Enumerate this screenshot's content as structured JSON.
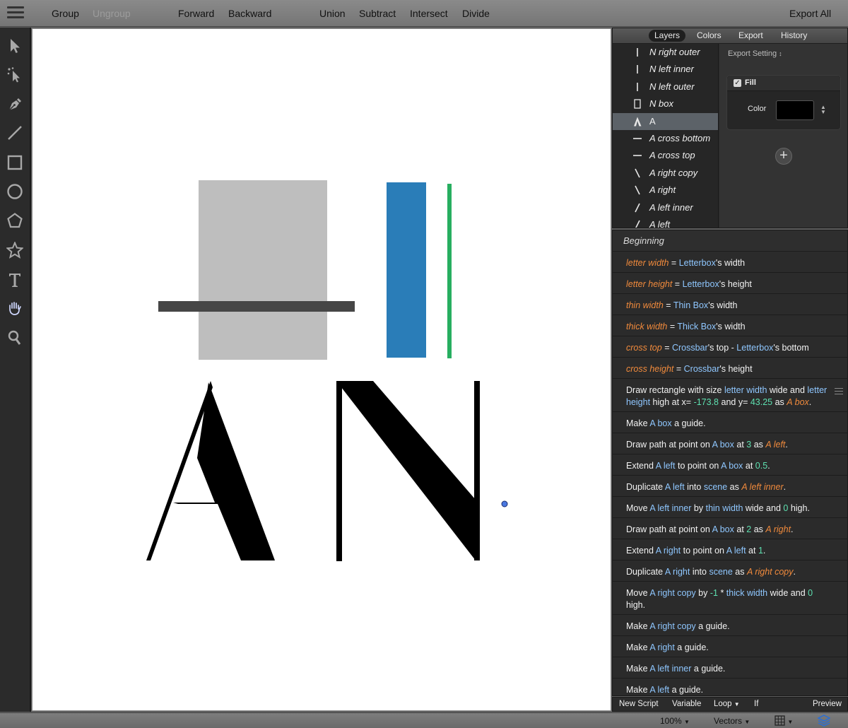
{
  "toolbar": {
    "group": "Group",
    "ungroup": "Ungroup",
    "forward": "Forward",
    "backward": "Backward",
    "union": "Union",
    "subtract": "Subtract",
    "intersect": "Intersect",
    "divide": "Divide",
    "export_all": "Export All"
  },
  "tools": [
    "select-tool",
    "direct-select-tool",
    "pen-tool",
    "line-tool",
    "rectangle-tool",
    "ellipse-tool",
    "polygon-tool",
    "star-tool",
    "text-tool",
    "hand-tool",
    "zoom-tool"
  ],
  "panel_tabs": [
    "Layers",
    "Colors",
    "Export",
    "History"
  ],
  "active_tab": "Layers",
  "layers": [
    {
      "name": "N right outer",
      "icon": "vbar"
    },
    {
      "name": "N left inner",
      "icon": "vbar"
    },
    {
      "name": "N left outer",
      "icon": "vbar"
    },
    {
      "name": "N box",
      "icon": "rect"
    },
    {
      "name": "A",
      "icon": "letter-a",
      "selected": true
    },
    {
      "name": "A cross bottom",
      "icon": "hbar"
    },
    {
      "name": "A cross top",
      "icon": "hbar"
    },
    {
      "name": "A right copy",
      "icon": "backslash"
    },
    {
      "name": "A right",
      "icon": "backslash"
    },
    {
      "name": "A left inner",
      "icon": "slash"
    },
    {
      "name": "A left",
      "icon": "slash"
    }
  ],
  "properties": {
    "export_setting": "Export Setting",
    "fill_label": "Fill",
    "fill_checked": true,
    "color_label": "Color",
    "color_value": "#000000",
    "add_label": "+"
  },
  "script": {
    "beginning": "Beginning",
    "statements": [
      [
        [
          "var",
          "letter width"
        ],
        [
          "plain",
          " = "
        ],
        [
          "ref",
          "Letterbox"
        ],
        [
          "plain",
          "'s width"
        ]
      ],
      [
        [
          "var",
          "letter height"
        ],
        [
          "plain",
          " = "
        ],
        [
          "ref",
          "Letterbox"
        ],
        [
          "plain",
          "'s height"
        ]
      ],
      [
        [
          "var",
          "thin width"
        ],
        [
          "plain",
          " = "
        ],
        [
          "ref",
          "Thin Box"
        ],
        [
          "plain",
          "'s width"
        ]
      ],
      [
        [
          "var",
          "thick width"
        ],
        [
          "plain",
          " = "
        ],
        [
          "ref",
          "Thick Box"
        ],
        [
          "plain",
          "'s width"
        ]
      ],
      [
        [
          "var",
          "cross top"
        ],
        [
          "plain",
          " = "
        ],
        [
          "ref",
          "Crossbar"
        ],
        [
          "plain",
          "'s top - "
        ],
        [
          "ref",
          "Letterbox"
        ],
        [
          "plain",
          "'s bottom"
        ]
      ],
      [
        [
          "var",
          "cross height"
        ],
        [
          "plain",
          " = "
        ],
        [
          "ref",
          "Crossbar"
        ],
        [
          "plain",
          "'s height"
        ]
      ],
      [
        [
          "plain",
          "Draw rectangle with size "
        ],
        [
          "ref",
          "letter width"
        ],
        [
          "plain",
          " wide and "
        ],
        [
          "ref",
          "letter height"
        ],
        [
          "plain",
          " high at x= "
        ],
        [
          "num",
          "-173.8"
        ],
        [
          "plain",
          " and y= "
        ],
        [
          "num",
          "43.25"
        ],
        [
          "plain",
          " as "
        ],
        [
          "var",
          "A box"
        ],
        [
          "plain",
          "."
        ]
      ],
      [
        [
          "plain",
          "Make "
        ],
        [
          "ref",
          "A box"
        ],
        [
          "plain",
          " a guide."
        ]
      ],
      [
        [
          "plain",
          "Draw path at point on "
        ],
        [
          "ref",
          "A box"
        ],
        [
          "plain",
          " at "
        ],
        [
          "num",
          "3"
        ],
        [
          "plain",
          " as "
        ],
        [
          "var",
          "A left"
        ],
        [
          "plain",
          "."
        ]
      ],
      [
        [
          "plain",
          "Extend "
        ],
        [
          "ref",
          "A left"
        ],
        [
          "plain",
          " to point on "
        ],
        [
          "ref",
          "A box"
        ],
        [
          "plain",
          " at "
        ],
        [
          "num",
          "0.5"
        ],
        [
          "plain",
          "."
        ]
      ],
      [
        [
          "plain",
          "Duplicate "
        ],
        [
          "ref",
          "A left"
        ],
        [
          "plain",
          " into "
        ],
        [
          "ref",
          "scene"
        ],
        [
          "plain",
          " as "
        ],
        [
          "var",
          "A left inner"
        ],
        [
          "plain",
          "."
        ]
      ],
      [
        [
          "plain",
          "Move "
        ],
        [
          "ref",
          "A left inner"
        ],
        [
          "plain",
          " by "
        ],
        [
          "ref",
          "thin width"
        ],
        [
          "plain",
          " wide and "
        ],
        [
          "num",
          "0"
        ],
        [
          "plain",
          " high."
        ]
      ],
      [
        [
          "plain",
          "Draw path at point on "
        ],
        [
          "ref",
          "A box"
        ],
        [
          "plain",
          " at "
        ],
        [
          "num",
          "2"
        ],
        [
          "plain",
          " as "
        ],
        [
          "var",
          "A right"
        ],
        [
          "plain",
          "."
        ]
      ],
      [
        [
          "plain",
          "Extend "
        ],
        [
          "ref",
          "A right"
        ],
        [
          "plain",
          " to point on "
        ],
        [
          "ref",
          "A left"
        ],
        [
          "plain",
          " at "
        ],
        [
          "num",
          "1"
        ],
        [
          "plain",
          "."
        ]
      ],
      [
        [
          "plain",
          "Duplicate "
        ],
        [
          "ref",
          "A right"
        ],
        [
          "plain",
          " into "
        ],
        [
          "ref",
          "scene"
        ],
        [
          "plain",
          " as "
        ],
        [
          "var",
          "A right copy"
        ],
        [
          "plain",
          "."
        ]
      ],
      [
        [
          "plain",
          "Move "
        ],
        [
          "ref",
          "A right copy"
        ],
        [
          "plain",
          " by "
        ],
        [
          "num",
          "-1"
        ],
        [
          "plain",
          " * "
        ],
        [
          "ref",
          "thick width"
        ],
        [
          "plain",
          " wide and "
        ],
        [
          "num",
          "0"
        ],
        [
          "plain",
          " high."
        ]
      ],
      [
        [
          "plain",
          "Make "
        ],
        [
          "ref",
          "A right copy"
        ],
        [
          "plain",
          " a guide."
        ]
      ],
      [
        [
          "plain",
          "Make "
        ],
        [
          "ref",
          "A right"
        ],
        [
          "plain",
          " a guide."
        ]
      ],
      [
        [
          "plain",
          "Make "
        ],
        [
          "ref",
          "A left inner"
        ],
        [
          "plain",
          " a guide."
        ]
      ],
      [
        [
          "plain",
          "Make "
        ],
        [
          "ref",
          "A left"
        ],
        [
          "plain",
          " a guide."
        ]
      ]
    ]
  },
  "script_footer": {
    "new_script": "New Script",
    "variable": "Variable",
    "loop": "Loop",
    "if_label": "If",
    "preview": "Preview"
  },
  "statusbar": {
    "zoom": "100%",
    "mode": "Vectors"
  },
  "canvas_colors": {
    "letterbox": "#bebebe",
    "crossbar": "#464646",
    "thick_box": "#2a7db8",
    "thin_box": "#27ae60",
    "glyph": "#000000",
    "handle": "#4a78e0"
  }
}
